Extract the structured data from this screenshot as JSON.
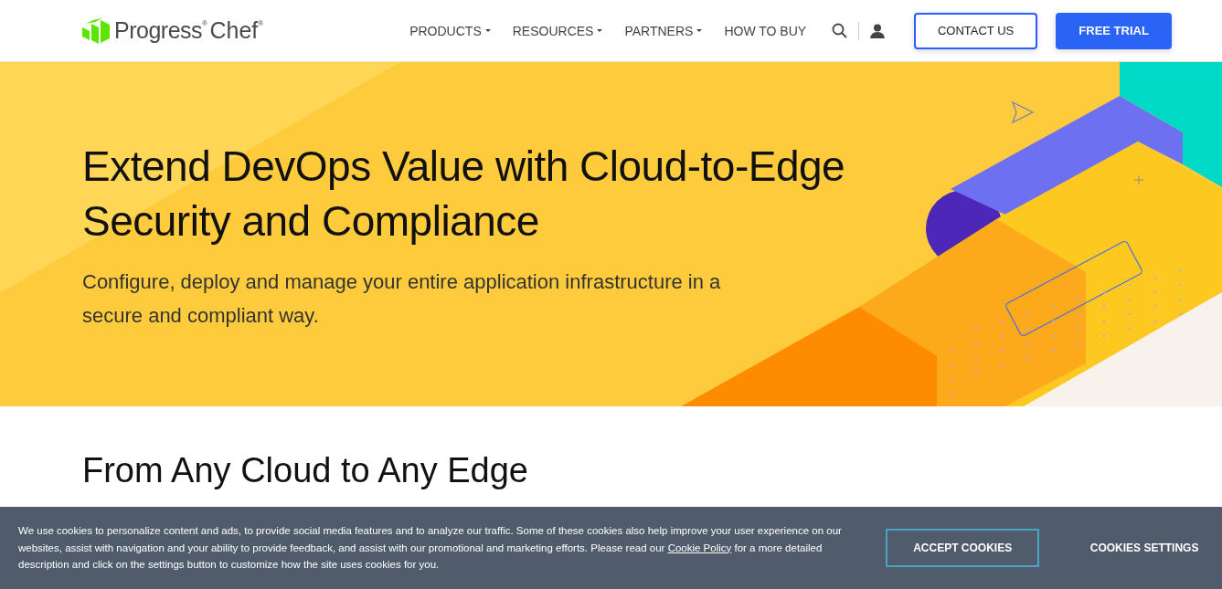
{
  "header": {
    "logo": {
      "brand": "Progress$^{®}$",
      "product": "Chef$^{®}$"
    },
    "nav": [
      {
        "label": "PRODUCTS",
        "dropdown": true
      },
      {
        "label": "RESOURCES",
        "dropdown": true
      },
      {
        "label": "PARTNERS",
        "dropdown": true
      },
      {
        "label": "HOW TO BUY",
        "dropdown": false
      }
    ],
    "buttons": [
      {
        "label": "CONTACT US",
        "kind": "outline"
      },
      {
        "label": "FREE TRIAL",
        "kind": "primary"
      }
    ]
  },
  "hero": {
    "title": "Extend DevOps Value with Cloud-to-Edge Security and Compliance",
    "subtitle": "Configure, deploy and manage your entire application infrastructure in a secure and compliant way."
  },
  "section": {
    "heading": "From Any Cloud to Any Edge"
  },
  "cookie_banner": {
    "text_before": "We use cookies to personalize content and ads, to provide social media features and to analyze our traffic. Some of these cookies also help improve your user experience on our websites, assist with navigation and your ability to provide feedback, and assist with our promotional and marketing efforts. Please read our ",
    "link": "Cookie Policy",
    "text_after": " for a more detailed description and click on the settings button to customize how the site uses cookies for you.",
    "buttons": [
      {
        "label": "ACCEPT COOKIES",
        "kind": "outline"
      },
      {
        "label": "COOKIES SETTINGS",
        "kind": "plain"
      }
    ]
  }
}
